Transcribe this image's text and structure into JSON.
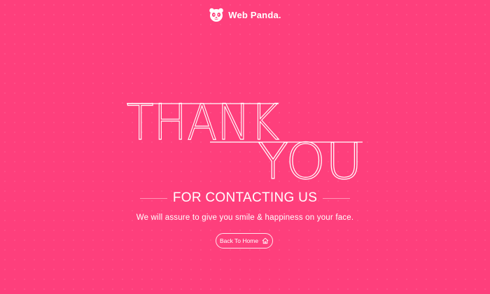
{
  "brand": {
    "name": "Web Panda.",
    "logo_icon": "panda-icon"
  },
  "hero": {
    "line1": "THANK",
    "line2": "YOU"
  },
  "subtitle": "FOR CONTACTING US",
  "message": "We will assure to give you smile & happiness on your face.",
  "home_button": {
    "label": "Back To Home",
    "icon": "home-icon"
  },
  "colors": {
    "background": "#fe3f7c",
    "text": "#ffffff"
  }
}
